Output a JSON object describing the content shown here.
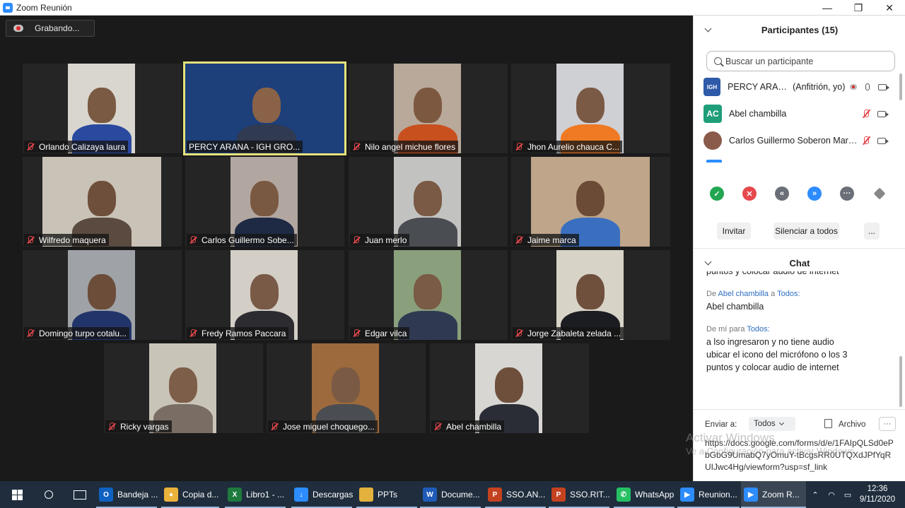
{
  "window": {
    "title": "Zoom Reunión",
    "minimize": "—",
    "restore": "❐",
    "close": "✕"
  },
  "recording": {
    "label": "Grabando..."
  },
  "tiles": [
    {
      "name": "Orlando Calizaya laura"
    },
    {
      "name": "PERCY ARANA - IGH GRO..."
    },
    {
      "name": "Nilo angel michue flores"
    },
    {
      "name": "Jhon Aurelio chauca C..."
    },
    {
      "name": "Wilfredo maquera"
    },
    {
      "name": "Carlos Guillermo Sobe..."
    },
    {
      "name": "Juan merlo"
    },
    {
      "name": "Jaime marca"
    },
    {
      "name": "Domingo turpo cotalu..."
    },
    {
      "name": "Fredy Ramos Paccara"
    },
    {
      "name": "Edgar vilca"
    },
    {
      "name": "Jorge Zabaleta zelada ..."
    },
    {
      "name": "Ricky vargas"
    },
    {
      "name": "Jose miguel choquego..."
    },
    {
      "name": "Abel chambilla"
    }
  ],
  "participants": {
    "title": "Participantes (15)",
    "search_placeholder": "Buscar un participante",
    "list": [
      {
        "avatar": "IGH",
        "name": "PERCY ARAN...",
        "role": "(Anfitrión, yo)",
        "avatar_color": "#2e5aa8"
      },
      {
        "avatar": "AC",
        "name": "Abel chambilla",
        "role": "",
        "avatar_color": "#1f9e7a"
      },
      {
        "avatar": "",
        "name": "Carlos Guillermo Soberon Martí...",
        "role": "",
        "avatar_color": "#8a5a4a"
      }
    ],
    "invite_label": "Invitar",
    "mute_all_label": "Silenciar a todos",
    "more_label": "..."
  },
  "chat": {
    "title": "Chat",
    "partial_top": "puntos y colocar audio de internet",
    "messages": [
      {
        "from_prefix": "De",
        "from": "Abel chambilla",
        "to_prefix": "a",
        "to": "Todos:",
        "lines": [
          "Abel chambilla"
        ]
      },
      {
        "from_prefix": "De",
        "from": "mí",
        "to_prefix": "para",
        "to": "Todos:",
        "lines": [
          "a lso ingresaron y no tiene audio",
          "ubicar el icono del micrófono o los 3",
          "puntos y colocar audio de internet"
        ]
      }
    ],
    "send_to_label": "Enviar a:",
    "send_to_value": "Todos",
    "file_label": "Archivo",
    "compose_text": "https://docs.google.com/forms/d/e/1FAIpQLSd0ePbGbG9UmabQ7yOmuY-tBcgsRR0UTQXdJPfYqRUIJwc4Hg/viewform?usp=sf_link"
  },
  "watermark": {
    "line1": "Activar Windows",
    "line2": "Ve a Configuración para activar Windows."
  },
  "taskbar": {
    "items": [
      "Bandeja ...",
      "Copia d...",
      "Libro1 - ...",
      "Descargas",
      "PPTs",
      "Docume...",
      "SSO.AN...",
      "SSO.RIT...",
      "WhatsApp",
      "Reunion...",
      "Zoom R..."
    ],
    "time": "12:36",
    "date": "9/11/2020"
  }
}
